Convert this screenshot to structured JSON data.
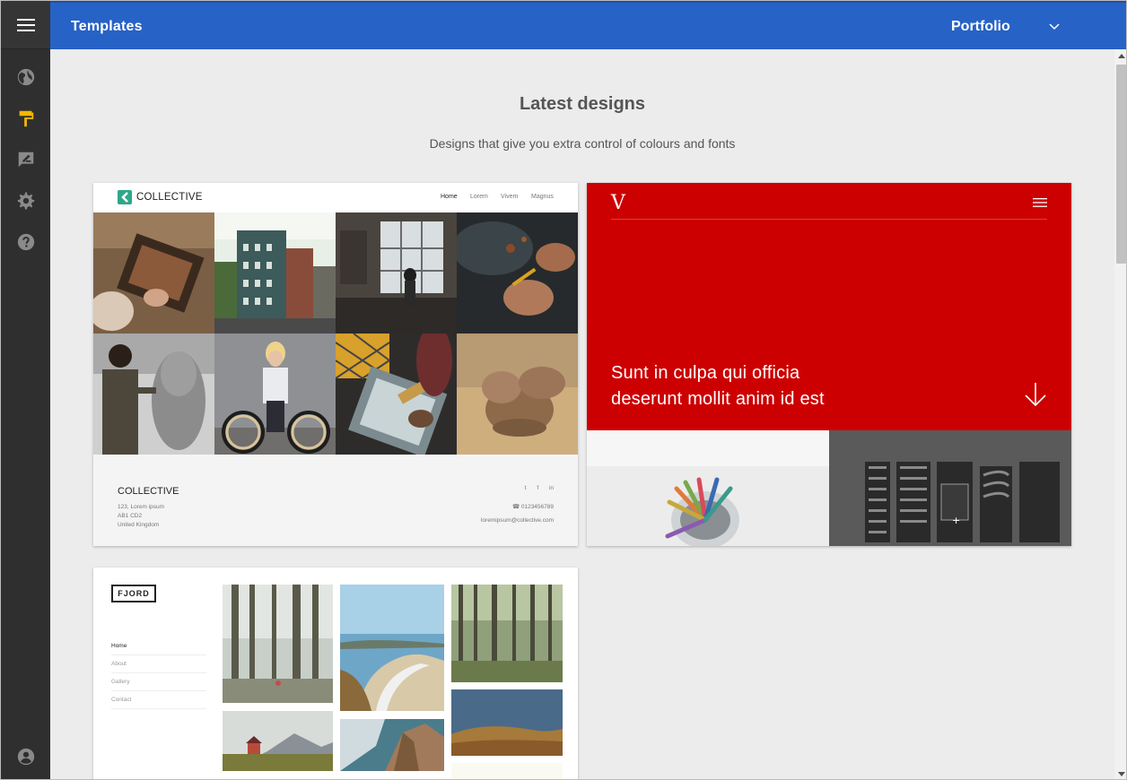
{
  "app": {
    "title": "Templates",
    "site_selector": "Portfolio"
  },
  "sidebar": {
    "items": [
      {
        "name": "globe-icon",
        "active": false
      },
      {
        "name": "paint-roller-icon",
        "active": true
      },
      {
        "name": "feedback-icon",
        "active": false
      },
      {
        "name": "gear-icon",
        "active": false
      },
      {
        "name": "help-icon",
        "active": false
      }
    ],
    "bottom": {
      "name": "account-icon"
    }
  },
  "main": {
    "heading": "Latest designs",
    "subheading": "Designs that give you extra control of colours and fonts"
  },
  "templates": {
    "collective": {
      "logo": "COLLECTIVE",
      "nav": [
        "Home",
        "Lorem",
        "Vivem",
        "Magnus"
      ],
      "footer_title": "COLLECTIVE",
      "address": [
        "123, Lorem ipsum",
        "AB1 CD2",
        "United Kingdom"
      ],
      "phone": "0123456789",
      "email": "loremipsum@collective.com",
      "social": [
        "t",
        "f",
        "in"
      ]
    },
    "v": {
      "logo": "V",
      "headline_line1": "Sunt in culpa qui officia",
      "headline_line2": "deserunt mollit anim id est"
    },
    "fjord": {
      "logo": "FJORD",
      "nav": [
        "Home",
        "About",
        "Gallery",
        "Contact"
      ]
    }
  },
  "colors": {
    "topbar": "#2762c6",
    "sidebar": "#2f2f2f",
    "accent_active": "#f5b800",
    "v_red": "#cc0000"
  }
}
